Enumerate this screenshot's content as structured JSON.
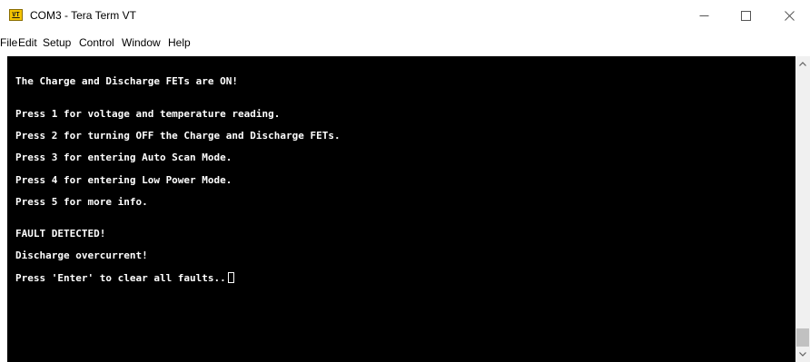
{
  "window": {
    "title": "COM3 - Tera Term VT",
    "app_icon_label": "VT"
  },
  "menu": [
    {
      "label": "File"
    },
    {
      "label": "Edit"
    },
    {
      "label": "Setup"
    },
    {
      "label": "Control"
    },
    {
      "label": "Window"
    },
    {
      "label": "Help"
    }
  ],
  "terminal": {
    "lines": [
      "The Charge and Discharge FETs are ON!",
      "Press 1 for voltage and temperature reading.",
      "Press 2 for turning OFF the Charge and Discharge FETs.",
      "Press 3 for entering Auto Scan Mode.",
      "Press 4 for entering Low Power Mode.",
      "Press 5 for more info.",
      "FAULT DETECTED!",
      "Discharge overcurrent!",
      "Press 'Enter' to clear all faults.."
    ],
    "background": "#000000",
    "foreground": "#ffffff"
  },
  "icons": {
    "minimize": "minimize-icon",
    "maximize": "maximize-icon",
    "close": "close-icon",
    "scroll_up": "chevron-up-icon",
    "scroll_down": "chevron-down-icon"
  }
}
